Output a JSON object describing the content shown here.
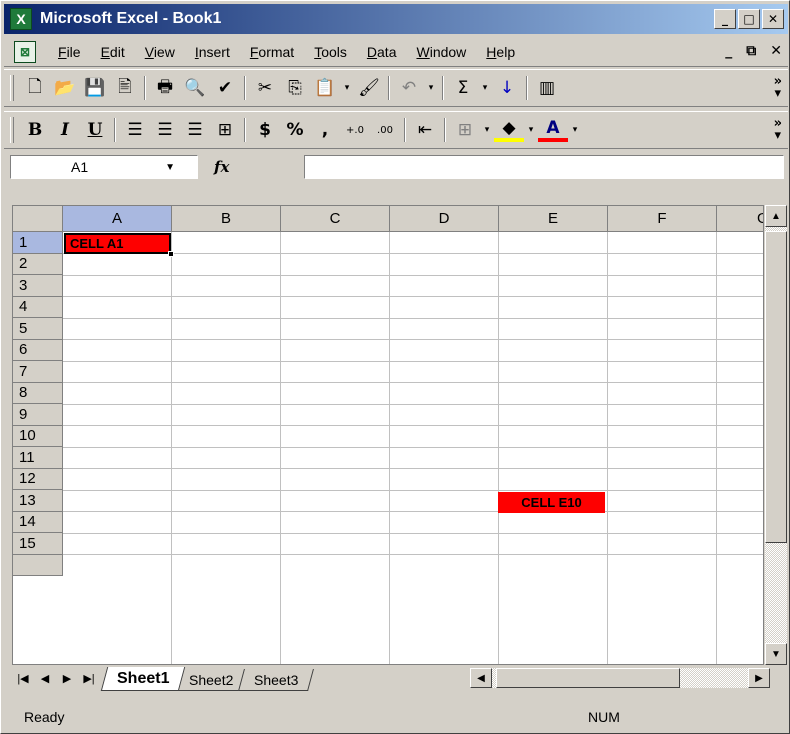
{
  "window": {
    "title": "Microsoft Excel - Book1",
    "app_icon_glyph": "X"
  },
  "title_buttons": [
    "_",
    "□",
    "✕"
  ],
  "menu": {
    "doc_icon_glyph": "⊠",
    "items": [
      "File",
      "Edit",
      "View",
      "Insert",
      "Format",
      "Tools",
      "Data",
      "Window",
      "Help"
    ],
    "right": [
      "_",
      "⧉",
      "✕"
    ]
  },
  "toolbar_standard": {
    "icons": [
      "new-icon",
      "open-icon",
      "save-icon",
      "permission-icon",
      "print-icon",
      "print-preview-icon",
      "spelling-icon",
      "cut-icon",
      "copy-icon",
      "paste-icon",
      "format-painter-icon",
      "undo-icon",
      "autosum-icon",
      "sort-ascending-icon",
      "chart-wizard-icon"
    ],
    "glyphs": [
      "🗋",
      "📂",
      "💾",
      "🖹",
      "🖶",
      "🔍",
      "✔",
      "✂",
      "⎘",
      "📋",
      "🖌",
      "↶",
      "Σ",
      "↓",
      "▥"
    ]
  },
  "toolbar_formatting": {
    "bold": "B",
    "italic": "I",
    "underline": "U",
    "currency": "$",
    "percent": "%",
    "comma": ",",
    "increase_decimal": "+.0",
    "decrease_decimal": ".00",
    "highlight_color": "#ffff00",
    "font_color": "#ff0000"
  },
  "formula_bar": {
    "name_box": "A1",
    "fx": "fx",
    "formula": ""
  },
  "sheet": {
    "columns": [
      "A",
      "B",
      "C",
      "D",
      "E",
      "F",
      "G"
    ],
    "rows": [
      "1",
      "2",
      "3",
      "4",
      "5",
      "6",
      "7",
      "8",
      "9",
      "10",
      "11",
      "12",
      "13",
      "14",
      "15"
    ],
    "active_column": "A",
    "active_row": "1",
    "cells": {
      "A1": "CELL A1",
      "E10": "CELL E10"
    },
    "cell_fill": "#ff0000"
  },
  "sheet_tabs": [
    "Sheet1",
    "Sheet2",
    "Sheet3"
  ],
  "active_sheet": "Sheet1",
  "status": {
    "ready": "Ready",
    "num": "NUM"
  }
}
